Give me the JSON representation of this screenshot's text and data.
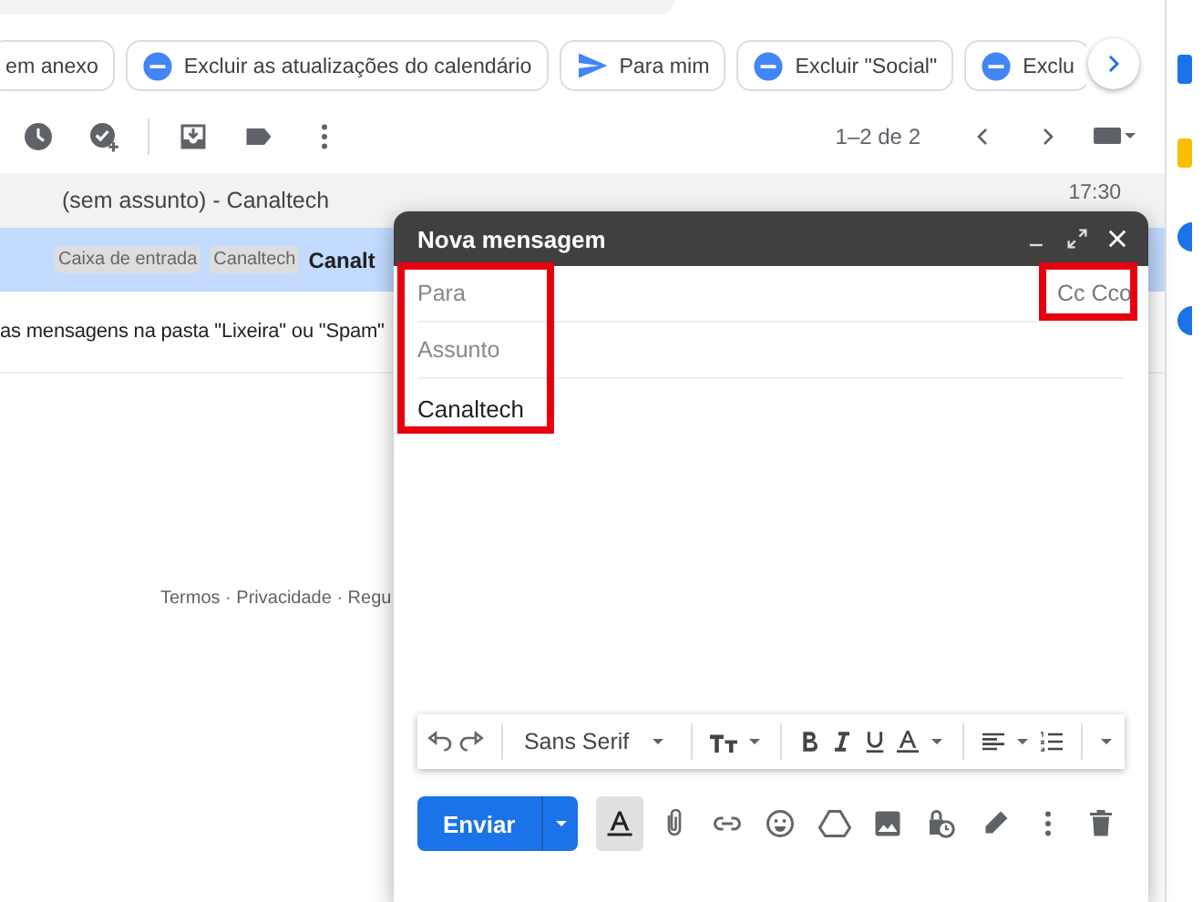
{
  "filters": [
    {
      "label": "em anexo",
      "kind": "plain"
    },
    {
      "label": "Excluir as atualizações do calendário",
      "kind": "exclude"
    },
    {
      "label": "Para mim",
      "kind": "send"
    },
    {
      "label": "Excluir \"Social\"",
      "kind": "exclude"
    },
    {
      "label": "Exclu",
      "kind": "exclude"
    }
  ],
  "pagination": "1–2 de 2",
  "emails": [
    {
      "subject": "(sem assunto) - Canaltech",
      "time": "17:30",
      "selected": false,
      "unread": false
    },
    {
      "labels": [
        "Caixa de entrada",
        "Canaltech"
      ],
      "subject": "Canalt",
      "selected": true,
      "unread": true
    }
  ],
  "notice": "as mensagens na pasta \"Lixeira\" ou \"Spam\"",
  "footer": "Termos · Privacidade · Regu",
  "compose": {
    "title": "Nova mensagem",
    "to": {
      "placeholder": "Para"
    },
    "cc": "Cc Cco",
    "subject": {
      "placeholder": "Assunto"
    },
    "body": "Canaltech",
    "font": "Sans Serif",
    "send": "Enviar",
    "fields_highlighted": true,
    "cc_highlighted": true
  }
}
